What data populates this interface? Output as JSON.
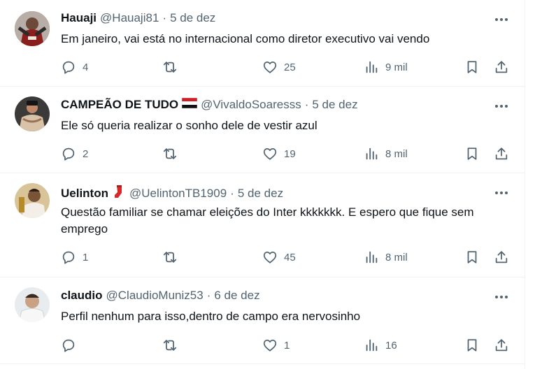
{
  "colors": {
    "text": "#0f1419",
    "secondary": "#536471",
    "divider": "#eff3f4"
  },
  "icons": {
    "reply": "reply-icon",
    "retweet": "retweet-icon",
    "like": "heart-icon",
    "views": "views-icon",
    "bookmark": "bookmark-icon",
    "share": "share-icon",
    "more": "more-icon"
  },
  "tweets": [
    {
      "name": "Hauaji",
      "handle": "@Hauaji81",
      "date": "5 de dez",
      "text": "Em janeiro, vai está no internacional como diretor executivo vai vendo",
      "replies": "4",
      "retweets": "",
      "likes": "25",
      "views": "9 mil"
    },
    {
      "name": "CAMPEÃO DE TUDO",
      "flag": "tricolor-flag",
      "handle": "@VivaldoSoaresss",
      "date": "5 de dez",
      "text": "Ele só queria realizar o sonho dele de vestir azul",
      "replies": "2",
      "retweets": "",
      "likes": "19",
      "views": "8 mil"
    },
    {
      "name": "Uelinton",
      "flag": "red-sock-emoji",
      "handle": "@UelintonTB1909",
      "date": "5 de dez",
      "text": "Questão familiar se chamar eleições do Inter kkkkkkk. E espero que fique sem emprego",
      "replies": "1",
      "retweets": "",
      "likes": "45",
      "views": "8 mil"
    },
    {
      "name": "claudio",
      "handle": "@ClaudioMuniz53",
      "date": "6 de dez",
      "text": "Perfil nenhum para isso,dentro de campo era nervosinho",
      "replies": "",
      "retweets": "",
      "likes": "1",
      "views": "16"
    }
  ]
}
